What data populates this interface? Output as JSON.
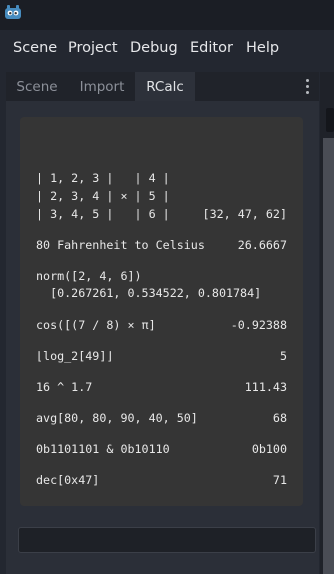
{
  "menu": [
    "Scene",
    "Project",
    "Debug",
    "Editor",
    "Help"
  ],
  "tabs": [
    "Scene",
    "Import",
    "RCalc"
  ],
  "active_tab": 2,
  "icons": {
    "logo": "godot-logo-icon",
    "menu": "kebab-menu-icon"
  },
  "colors": {
    "accent": "#478cbf",
    "output_bg": "#353535"
  },
  "output_lines": [
    {
      "expr": "| 1, 2, 3 |   | 4 |",
      "result": ""
    },
    {
      "expr": "| 2, 3, 4 | × | 5 |",
      "result": ""
    },
    {
      "expr": "| 3, 4, 5 |   | 6 |",
      "result": "[32, 47, 62]"
    },
    {
      "expr": "80 Fahrenheit to Celsius",
      "result": "26.6667"
    },
    {
      "expr": "norm([2, 4, 6])",
      "result": ""
    },
    {
      "expr": "  [0.267261, 0.534522, 0.801784]",
      "result": ""
    },
    {
      "expr": "cos([(7 / 8) × π]",
      "result": "-0.92388"
    },
    {
      "expr": "⌊log_2[49]⌋",
      "result": "5"
    },
    {
      "expr": "16 ^ 1.7",
      "result": "111.43"
    },
    {
      "expr": "avg[80, 80, 90, 40, 50]",
      "result": "68"
    },
    {
      "expr": "0b1101101 & 0b10110",
      "result": "0b100"
    },
    {
      "expr": "dec[0x47]",
      "result": "71"
    }
  ],
  "input": {
    "value": ""
  }
}
